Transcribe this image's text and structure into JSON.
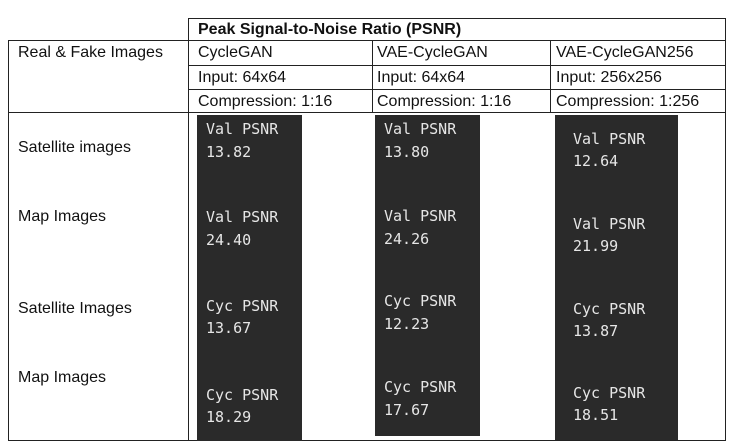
{
  "table": {
    "title": "Peak Signal-to-Noise Ratio (PSNR)",
    "corner_label": "Real & Fake Images",
    "columns": [
      {
        "name": "CycleGAN",
        "input": "Input: 64x64",
        "compression": "Compression: 1:16"
      },
      {
        "name": "VAE-CycleGAN",
        "input": "Input: 64x64",
        "compression": "Compression: 1:16"
      },
      {
        "name": "VAE-CycleGAN256",
        "input": "Input: 256x256",
        "compression": "Compression: 1:256"
      }
    ],
    "row_labels": [
      "Satellite images",
      "Map Images",
      "Satellite Images",
      "Map Images"
    ],
    "cells": [
      [
        {
          "label": "Val PSNR",
          "value": "13.82"
        },
        {
          "label": "Val PSNR",
          "value": "24.40"
        },
        {
          "label": "Cyc PSNR",
          "value": "13.67"
        },
        {
          "label": "Cyc PSNR",
          "value": "18.29"
        }
      ],
      [
        {
          "label": "Val PSNR",
          "value": "13.80"
        },
        {
          "label": "Val PSNR",
          "value": "24.26"
        },
        {
          "label": "Cyc PSNR",
          "value": "12.23"
        },
        {
          "label": "Cyc PSNR",
          "value": "17.67"
        }
      ],
      [
        {
          "label": "Val PSNR",
          "value": "12.64"
        },
        {
          "label": "Val PSNR",
          "value": "21.99"
        },
        {
          "label": "Cyc PSNR",
          "value": "13.87"
        },
        {
          "label": "Cyc PSNR",
          "value": "18.51"
        }
      ]
    ]
  }
}
